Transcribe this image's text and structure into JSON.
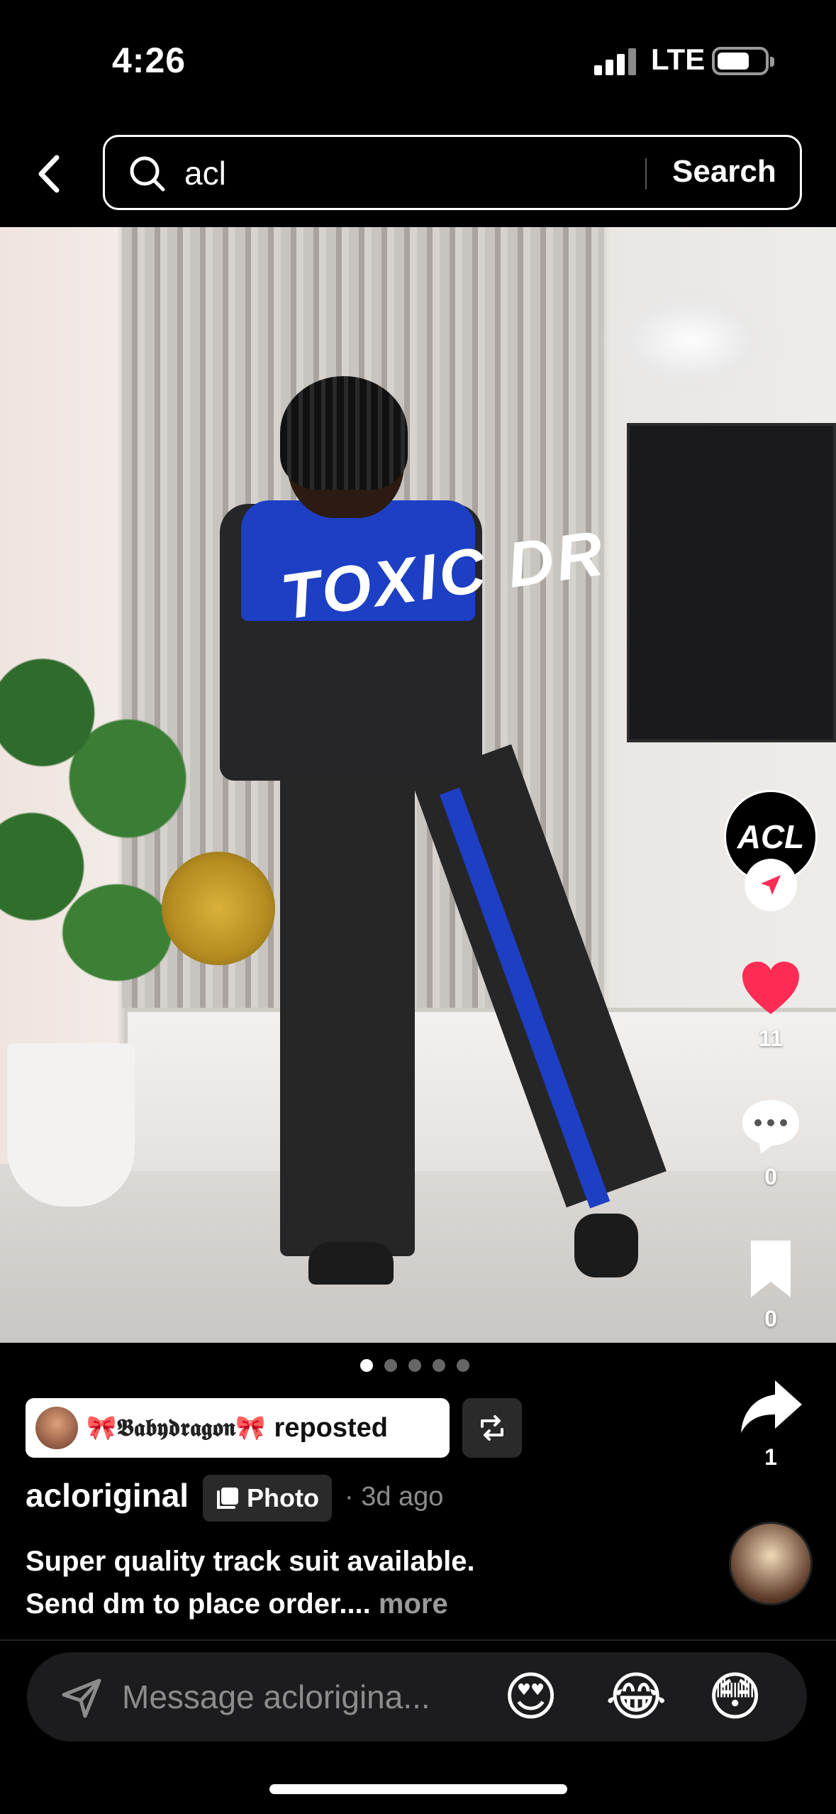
{
  "status": {
    "time": "4:26",
    "network": "LTE"
  },
  "search": {
    "query": "acl",
    "submit_label": "Search"
  },
  "photo": {
    "jacket_print": "TOXIC DR",
    "carousel_total": 5,
    "carousel_active": 1
  },
  "actions": {
    "profile_label": "ACL",
    "likes": "11",
    "comments": "0",
    "saves": "0",
    "shares": "1"
  },
  "post": {
    "repost_user": "🎀𝕭𝖆𝖇𝖞𝖉𝖗𝖆𝖌𝖔𝖓🎀",
    "repost_verb": "reposted",
    "username": "acloriginal",
    "type_label": "Photo",
    "time_ago": "· 3d ago",
    "caption_line1": "Super quality track suit available.",
    "caption_line2": "Send dm to place order....",
    "more_label": "more"
  },
  "message": {
    "placeholder": "Message acloriginal...",
    "display_placeholder": "Message acloriginа...",
    "emojis": [
      "😍",
      "😂",
      "😳"
    ]
  },
  "colors": {
    "background": "#000000",
    "like_red": "#fe2c55",
    "jacket_blue": "#1d3fc4",
    "muted_text": "#8c8c8c"
  }
}
